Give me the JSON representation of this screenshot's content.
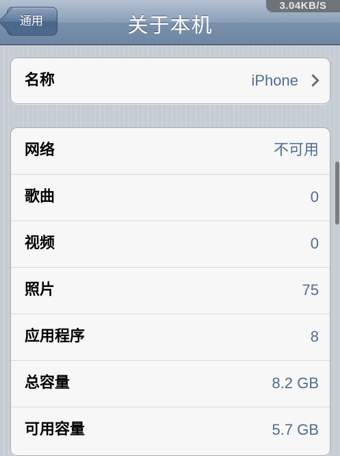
{
  "status": {
    "speed": "3.04KB/S"
  },
  "navbar": {
    "back_label": "通用",
    "title": "关于本机"
  },
  "name_row": {
    "label": "名称",
    "value": "iPhone"
  },
  "info_rows": [
    {
      "label": "网络",
      "value": "不可用"
    },
    {
      "label": "歌曲",
      "value": "0"
    },
    {
      "label": "视频",
      "value": "0"
    },
    {
      "label": "照片",
      "value": "75"
    },
    {
      "label": "应用程序",
      "value": "8"
    },
    {
      "label": "总容量",
      "value": "8.2 GB"
    },
    {
      "label": "可用容量",
      "value": "5.7 GB"
    }
  ],
  "colors": {
    "value_text": "#4f6d8f",
    "nav_bar": "#6d86a3",
    "background": "#c5ccd4"
  }
}
